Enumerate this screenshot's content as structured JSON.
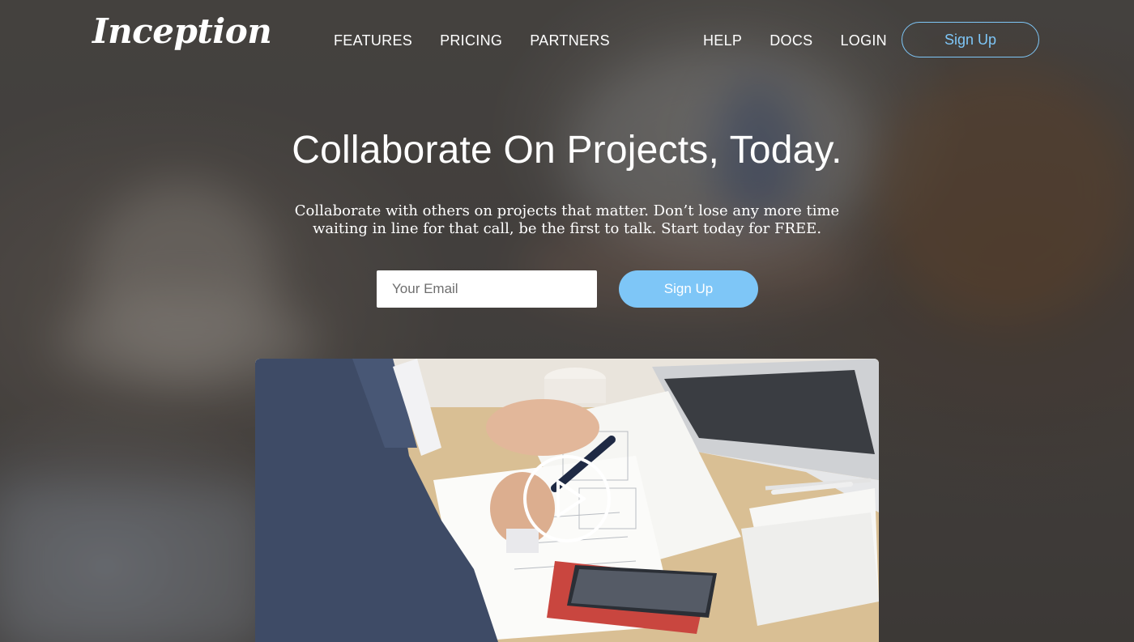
{
  "nav": {
    "logo": "Inception",
    "left_links": [
      "FEATURES",
      "PRICING",
      "PARTNERS"
    ],
    "right_links": [
      "HELP",
      "DOCS",
      "LOGIN"
    ],
    "signup_label": "Sign Up"
  },
  "hero": {
    "title": "Collaborate On Projects, Today.",
    "subtitle": "Collaborate with others on projects that matter. Don’t lose any more time waiting in line for that call, be the first to talk. Start today for FREE.",
    "email_placeholder": "Your Email",
    "signup_label": "Sign Up"
  },
  "video": {
    "play_icon": "play-circle-icon"
  },
  "colors": {
    "accent": "#7ec6f7",
    "text": "#ffffff"
  }
}
